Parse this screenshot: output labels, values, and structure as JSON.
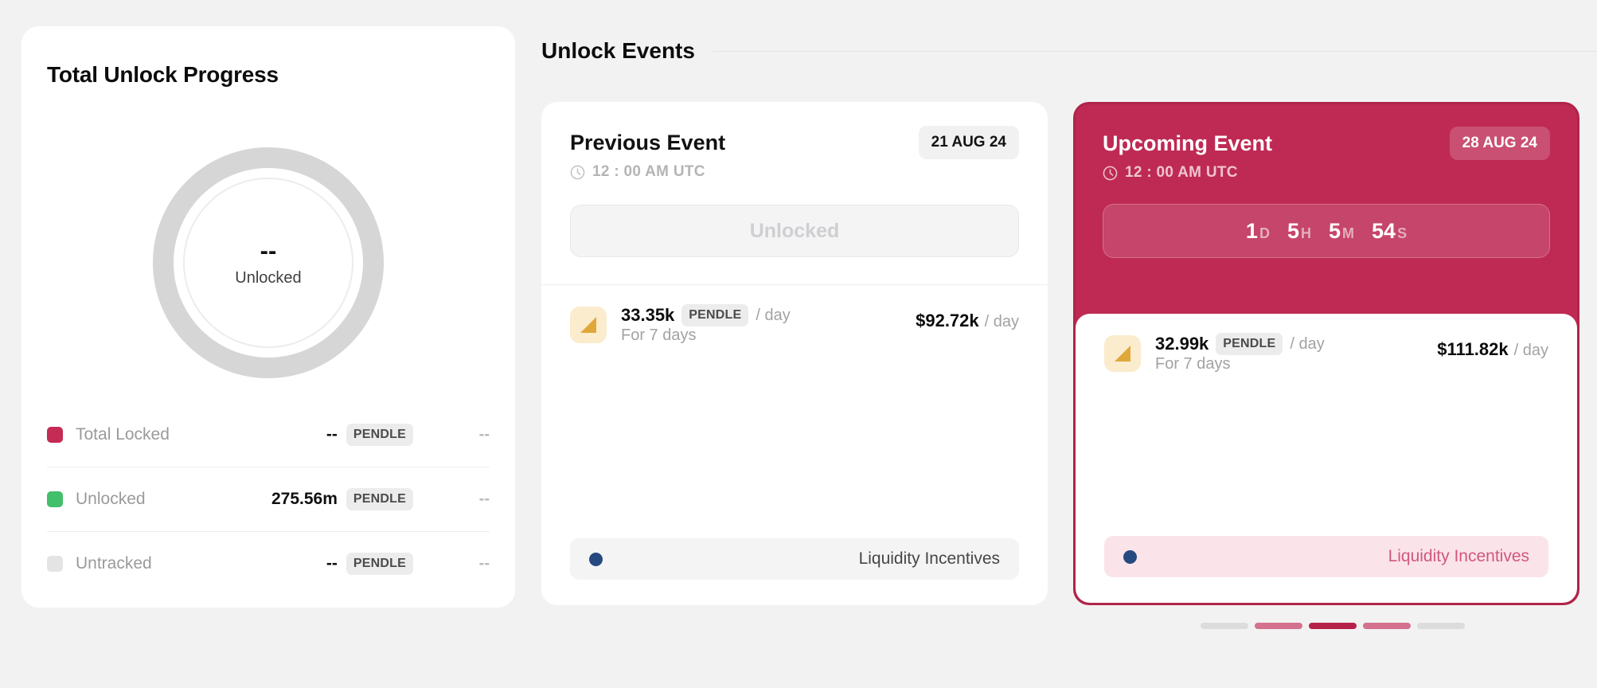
{
  "progress": {
    "title": "Total Unlock Progress",
    "donut": {
      "value": "--",
      "label": "Unlocked"
    },
    "legend": [
      {
        "name": "Total Locked",
        "amount": "--",
        "token": "PENDLE",
        "right": "--",
        "color": "#c42b55"
      },
      {
        "name": "Unlocked",
        "amount": "275.56m",
        "token": "PENDLE",
        "right": "--",
        "color": "#41bf6a"
      },
      {
        "name": "Untracked",
        "amount": "--",
        "token": "PENDLE",
        "right": "--",
        "color": "#e4e4e4"
      }
    ]
  },
  "events": {
    "title": "Unlock Events",
    "previous": {
      "title": "Previous Event",
      "date": "21 AUG 24",
      "time": "12 : 00 AM UTC",
      "status_button": "Unlocked",
      "amount": "33.35k",
      "token": "PENDLE",
      "per_day": "/ day",
      "duration": "For 7 days",
      "usd": "$92.72k",
      "usd_unit": "/ day",
      "tag": "Liquidity Incentives"
    },
    "upcoming": {
      "title": "Upcoming Event",
      "date": "28 AUG 24",
      "time": "12 : 00 AM UTC",
      "countdown": [
        {
          "num": "1",
          "unit": "D"
        },
        {
          "num": "5",
          "unit": "H"
        },
        {
          "num": "5",
          "unit": "M"
        },
        {
          "num": "54",
          "unit": "S"
        }
      ],
      "amount": "32.99k",
      "token": "PENDLE",
      "per_day": "/ day",
      "duration": "For 7 days",
      "usd": "$111.82k",
      "usd_unit": "/ day",
      "tag": "Liquidity Incentives"
    },
    "pagination": [
      "#dcdcdc",
      "#d4718e",
      "#b5234b",
      "#d4718e",
      "#dcdcdc"
    ]
  },
  "colors": {
    "brand": "#be2a54",
    "accent_green": "#41bf6a",
    "tag_dot": "#264a80",
    "icon_amber": "#e0a83a"
  }
}
